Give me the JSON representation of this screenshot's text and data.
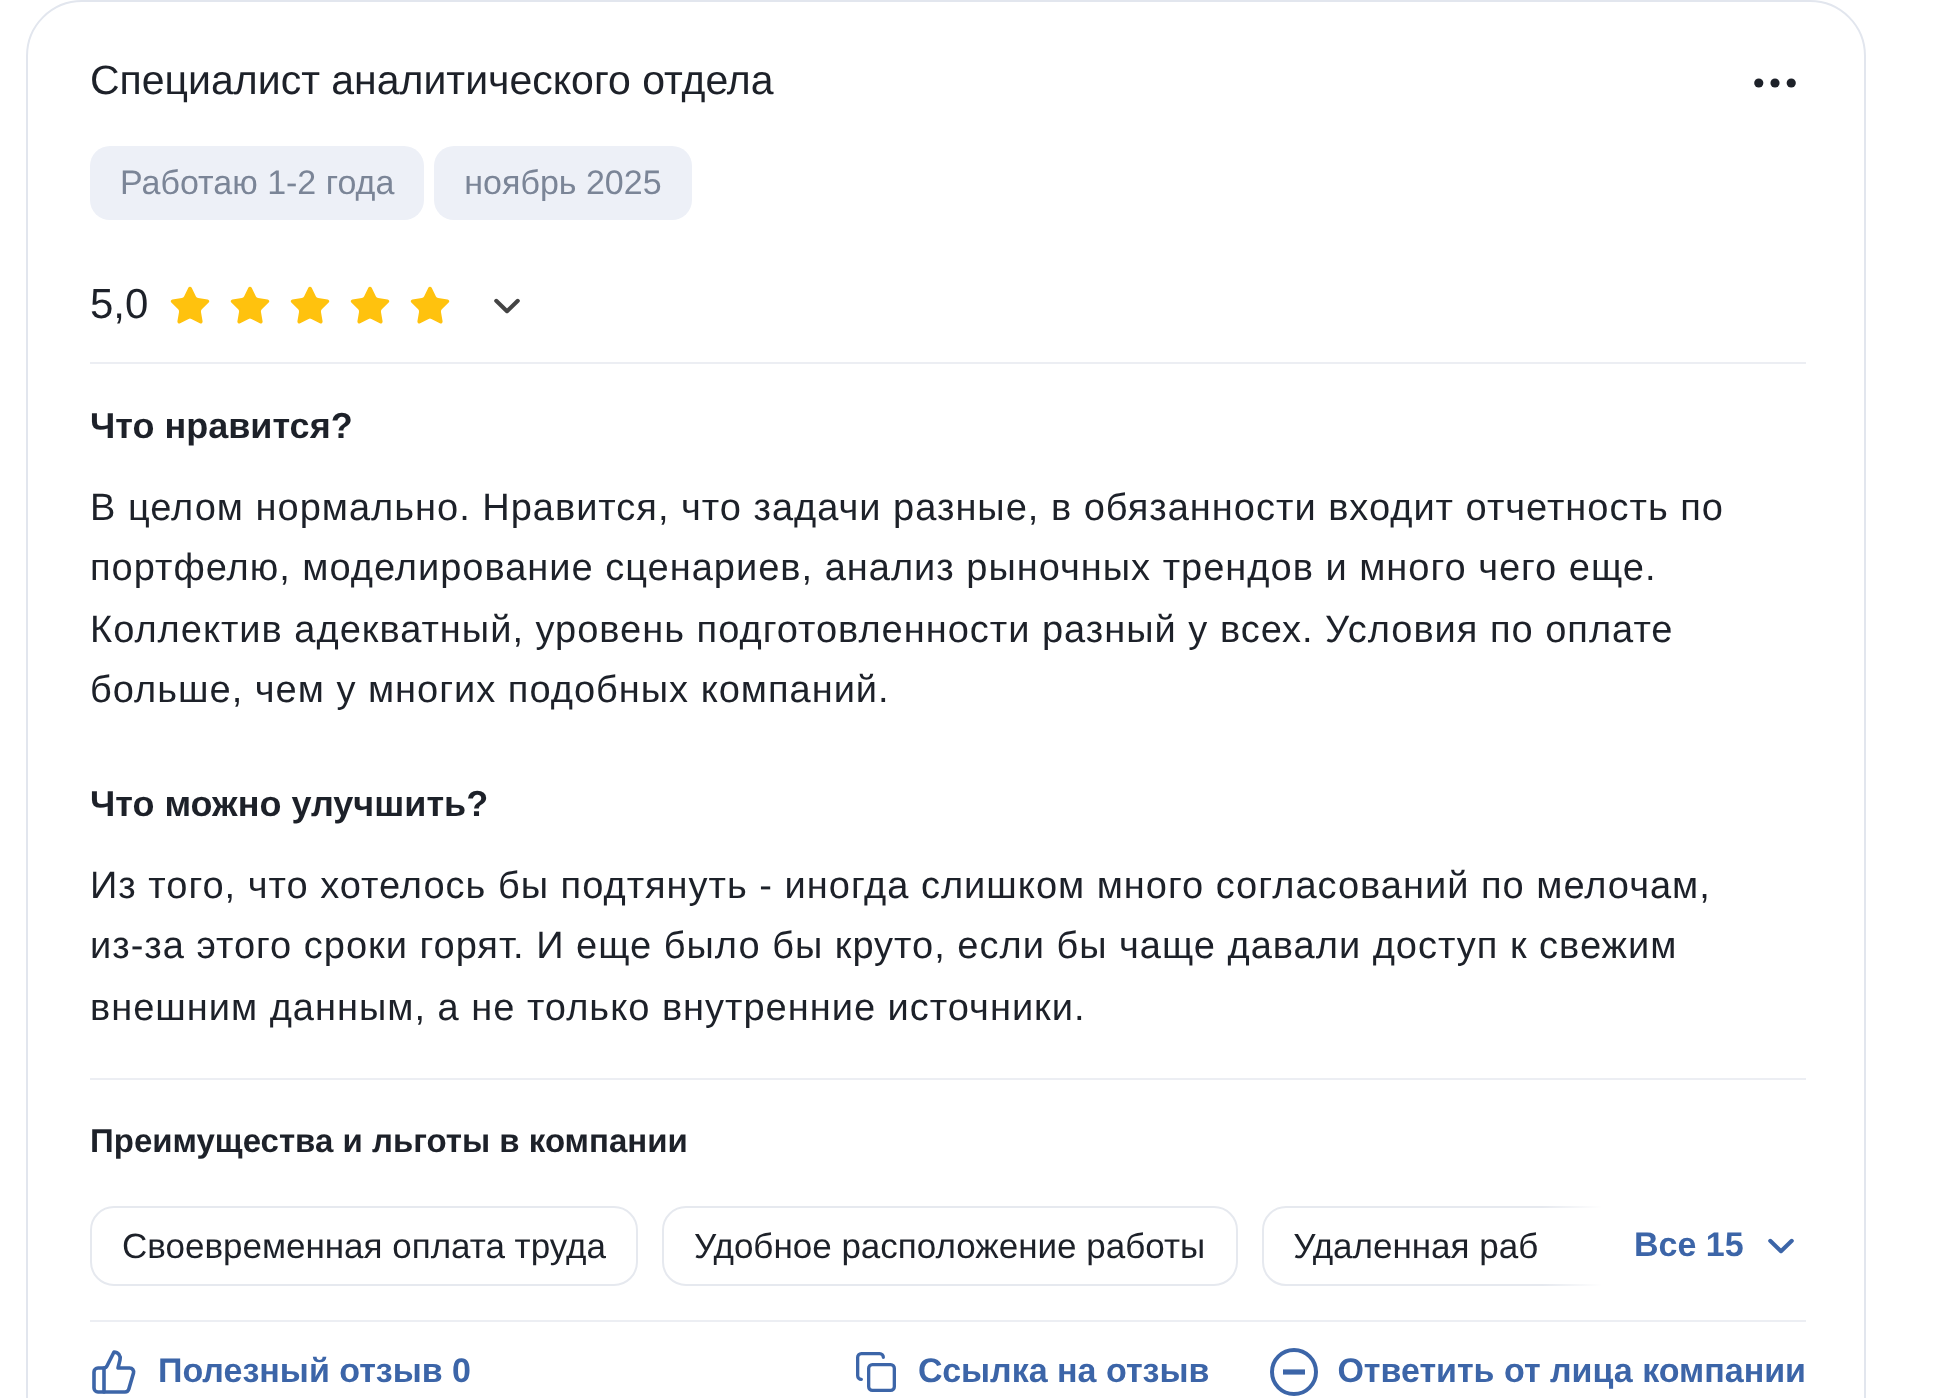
{
  "review": {
    "title": "Специалист аналитического отдела",
    "tags": [
      "Работаю 1-2 года",
      "ноябрь 2025"
    ]
  },
  "rating": {
    "value": "5,0",
    "stars": 5
  },
  "sections": [
    {
      "heading": "Что нравится?",
      "text": "В целом нормально. Нравится, что задачи разные, в обязанности входит отчетность по портфелю, моделирование сценариев, анализ рыночных трендов и много чего еще. Коллектив адекватный, уровень подготовленности разный у всех. Условия по оплате больше, чем у многих подобных компаний."
    },
    {
      "heading": "Что можно улучшить?",
      "text": "Из того, что хотелось бы подтянуть - иногда слишком много согласований по мелочам, из-за этого сроки горят. И еще было бы круто, если бы чаще давали доступ к свежим внешним данным, а не только внутренние источники."
    }
  ],
  "benefits": {
    "heading": "Преимущества и льготы в компании",
    "chips": [
      "Своевременная оплата труда",
      "Удобное расположение работы",
      "Удаленная раб"
    ],
    "more": "Все 15"
  },
  "actions": [
    {
      "kind": "like",
      "label": "Полезный отзыв 0"
    },
    {
      "kind": "link",
      "label": "Ссылка на отзыв"
    },
    {
      "kind": "reply",
      "label": "Ответить от лица компании"
    }
  ]
}
